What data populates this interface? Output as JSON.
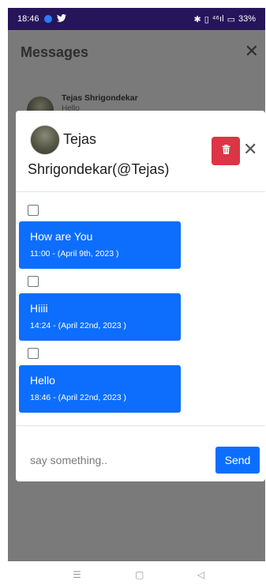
{
  "status_bar": {
    "time": "18:46",
    "network_status": "⁴⁶ıl",
    "battery": "33%"
  },
  "app": {
    "title": "Messages",
    "conversations": [
      {
        "name": "Tejas Shrigondekar",
        "preview": "Hello"
      }
    ]
  },
  "modal": {
    "name_line1": "Tejas",
    "name_line2": "Shrigondekar(@Tejas)",
    "messages": [
      {
        "text": "How are You",
        "time": "11:00 - (April 9th, 2023 )"
      },
      {
        "text": "Hiiii",
        "time": "14:24 - (April 22nd, 2023 )"
      },
      {
        "text": "Hello",
        "time": "18:46 - (April 22nd, 2023 )"
      }
    ],
    "input_placeholder": "say something..",
    "send_label": "Send"
  },
  "colors": {
    "accent": "#0d6efd",
    "danger": "#dc3545",
    "status_bar": "#27155a",
    "overlay": "#7a7a7a"
  },
  "icons": {
    "delete": "trash-icon",
    "close": "close-icon",
    "nav": [
      "menu-icon",
      "home-icon",
      "back-icon"
    ]
  }
}
